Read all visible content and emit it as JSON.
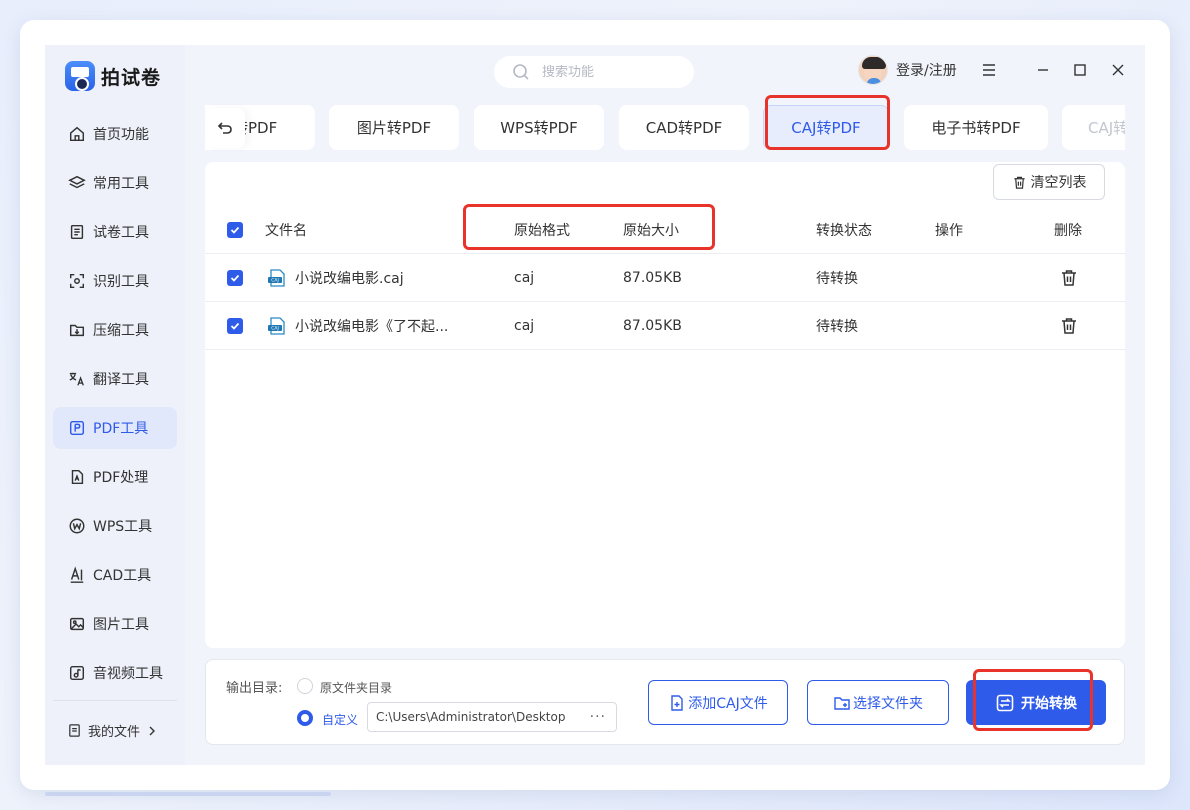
{
  "app": {
    "name": "拍试卷"
  },
  "search": {
    "placeholder": "搜索功能"
  },
  "user": {
    "login_label": "登录/注册"
  },
  "sidebar": {
    "items": [
      {
        "label": "首页功能",
        "icon": "home-icon"
      },
      {
        "label": "常用工具",
        "icon": "layers-icon"
      },
      {
        "label": "试卷工具",
        "icon": "exam-icon"
      },
      {
        "label": "识别工具",
        "icon": "scan-icon"
      },
      {
        "label": "压缩工具",
        "icon": "compress-icon"
      },
      {
        "label": "翻译工具",
        "icon": "translate-icon"
      },
      {
        "label": "PDF工具",
        "icon": "pdf-icon",
        "active": true
      },
      {
        "label": "PDF处理",
        "icon": "pdf-edit-icon"
      },
      {
        "label": "WPS工具",
        "icon": "wps-icon"
      },
      {
        "label": "CAD工具",
        "icon": "cad-icon"
      },
      {
        "label": "图片工具",
        "icon": "image-icon"
      },
      {
        "label": "音视频工具",
        "icon": "media-icon"
      }
    ],
    "my_files": "我的文件"
  },
  "tabs": [
    {
      "label": "转PDF"
    },
    {
      "label": "图片转PDF"
    },
    {
      "label": "WPS转PDF"
    },
    {
      "label": "CAD转PDF"
    },
    {
      "label": "CAJ转PDF",
      "active": true
    },
    {
      "label": "电子书转PDF"
    },
    {
      "label": "CAJ转"
    }
  ],
  "toolbar": {
    "clear_label": "清空列表"
  },
  "table": {
    "headers": {
      "name": "文件名",
      "format": "原始格式",
      "size": "原始大小",
      "status": "转换状态",
      "action": "操作",
      "delete": "删除"
    },
    "rows": [
      {
        "name": "小说改编电影.caj",
        "format": "caj",
        "size": "87.05KB",
        "status": "待转换",
        "checked": true
      },
      {
        "name": "小说改编电影《了不起...",
        "format": "caj",
        "size": "87.05KB",
        "status": "待转换",
        "checked": true
      }
    ]
  },
  "output": {
    "label": "输出目录:",
    "option_original": "原文件夹目录",
    "option_custom": "自定义",
    "path": "C:\\Users\\Administrator\\Desktop",
    "more": "···"
  },
  "buttons": {
    "add_file": "添加CAJ文件",
    "select_folder": "选择文件夹",
    "start": "开始转换"
  },
  "colors": {
    "accent": "#2f5bea",
    "annotation": "#e8332a"
  }
}
